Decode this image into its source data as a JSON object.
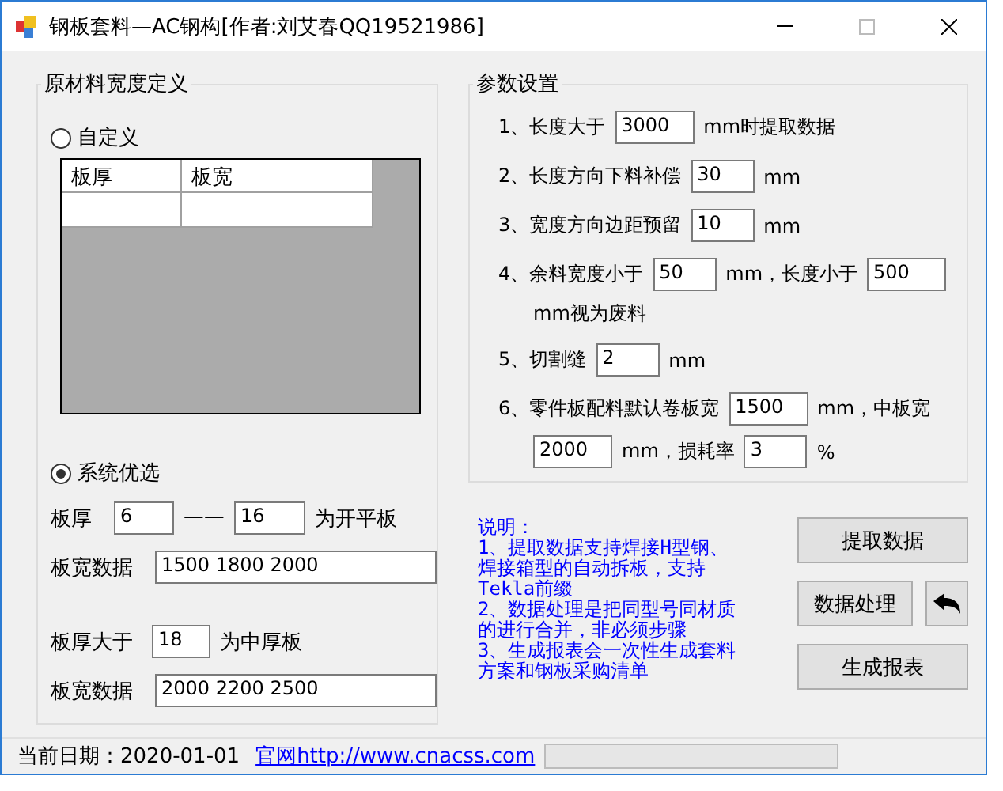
{
  "window": {
    "title": "钢板套料—AC钢构[作者:刘艾春QQ19521986]"
  },
  "material_width": {
    "title": "原材料宽度定义",
    "custom": {
      "label": "自定义",
      "selected": false,
      "columns": [
        "板厚",
        "板宽"
      ]
    },
    "system": {
      "label": "系统优选",
      "selected": true
    },
    "open_plate": {
      "label": "板厚",
      "from": "6",
      "separator": "一一",
      "to": "16",
      "suffix": "为开平板"
    },
    "open_widths": {
      "label": "板宽数据",
      "value": "1500 1800 2000"
    },
    "thick_plate": {
      "label": "板厚大于",
      "value": "18",
      "suffix": "为中厚板"
    },
    "thick_widths": {
      "label": "板宽数据",
      "value": "2000 2200 2500"
    }
  },
  "parameters": {
    "title": "参数设置",
    "rows": [
      {
        "lines": [
          [
            {
              "kind": "text",
              "text": "1、长度大于"
            },
            {
              "kind": "field",
              "value": "3000"
            },
            {
              "kind": "text",
              "text": "mm时提取数据"
            }
          ]
        ]
      },
      {
        "lines": [
          [
            {
              "kind": "text",
              "text": "2、长度方向下料补偿"
            },
            {
              "kind": "field",
              "value": "30"
            },
            {
              "kind": "text",
              "text": "mm"
            }
          ]
        ]
      },
      {
        "lines": [
          [
            {
              "kind": "text",
              "text": "3、宽度方向边距预留"
            },
            {
              "kind": "field",
              "value": "10"
            },
            {
              "kind": "text",
              "text": "mm"
            }
          ]
        ]
      },
      {
        "lines": [
          [
            {
              "kind": "text",
              "text": "4、余料宽度小于"
            },
            {
              "kind": "field",
              "value": "50"
            },
            {
              "kind": "text",
              "text": "mm，长度小于"
            },
            {
              "kind": "field",
              "value": "500"
            }
          ],
          [
            {
              "kind": "text",
              "text": "mm视为废料"
            }
          ]
        ]
      },
      {
        "lines": [
          [
            {
              "kind": "text",
              "text": "5、切割缝"
            },
            {
              "kind": "field",
              "value": "2"
            },
            {
              "kind": "text",
              "text": "mm"
            }
          ]
        ]
      },
      {
        "lines": [
          [
            {
              "kind": "text",
              "text": "6、零件板配料默认卷板宽"
            },
            {
              "kind": "field",
              "value": "1500"
            },
            {
              "kind": "text",
              "text": "mm，中板宽"
            }
          ],
          [
            {
              "kind": "field",
              "value": "2000"
            },
            {
              "kind": "text",
              "text": "mm，损耗率"
            },
            {
              "kind": "field",
              "value": "3"
            },
            {
              "kind": "text",
              "text": "%"
            }
          ]
        ]
      }
    ]
  },
  "notes": [
    "说明：",
    "1、提取数据支持焊接H型钢、焊接箱型的自动拆板，支持Tekla前缀",
    "2、数据处理是把同型号同材质的进行合并，非必须步骤",
    "3、生成报表会一次性生成套料方案和钢板采购清单"
  ],
  "buttons": [
    {
      "kind": "text",
      "label": "提取数据"
    },
    {
      "kind": "text",
      "label": "数据处理"
    },
    {
      "kind": "icon"
    },
    {
      "kind": "text",
      "label": "生成报表"
    }
  ],
  "status_bar": {
    "date": "当前日期：2020-01-01",
    "link": "官网http://www.cnacss.com",
    "progress": {
      "level": 0
    }
  }
}
